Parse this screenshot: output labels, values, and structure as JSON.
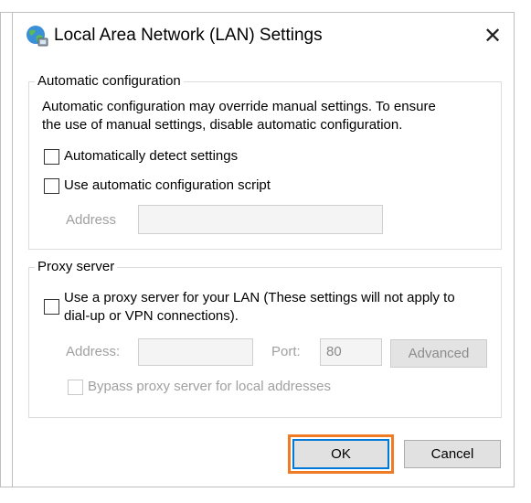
{
  "window": {
    "title": "Local Area Network (LAN) Settings",
    "icon": "globe-network-icon",
    "close_glyph": "✕"
  },
  "auto_config": {
    "legend": "Automatic configuration",
    "description_line1": "Automatic configuration may override manual settings.  To ensure",
    "description_line2": "the use of manual settings, disable automatic configuration.",
    "detect_label": "Automatically detect settings",
    "detect_checked": false,
    "script_label": "Use automatic configuration script",
    "script_checked": false,
    "address_label": "Address",
    "address_value": ""
  },
  "proxy": {
    "legend": "Proxy server",
    "use_proxy_line1": "Use a proxy server for your LAN (These settings will not apply to",
    "use_proxy_line2": "dial-up or VPN connections).",
    "use_proxy_checked": false,
    "address_label": "Address:",
    "address_value": "",
    "port_label": "Port:",
    "port_value": "80",
    "advanced_label": "Advanced",
    "bypass_label": "Bypass proxy server for local addresses",
    "bypass_checked": false
  },
  "buttons": {
    "ok_label": "OK",
    "cancel_label": "Cancel"
  },
  "colors": {
    "highlight": "#ef7b24",
    "default_button_border": "#0078d7"
  }
}
